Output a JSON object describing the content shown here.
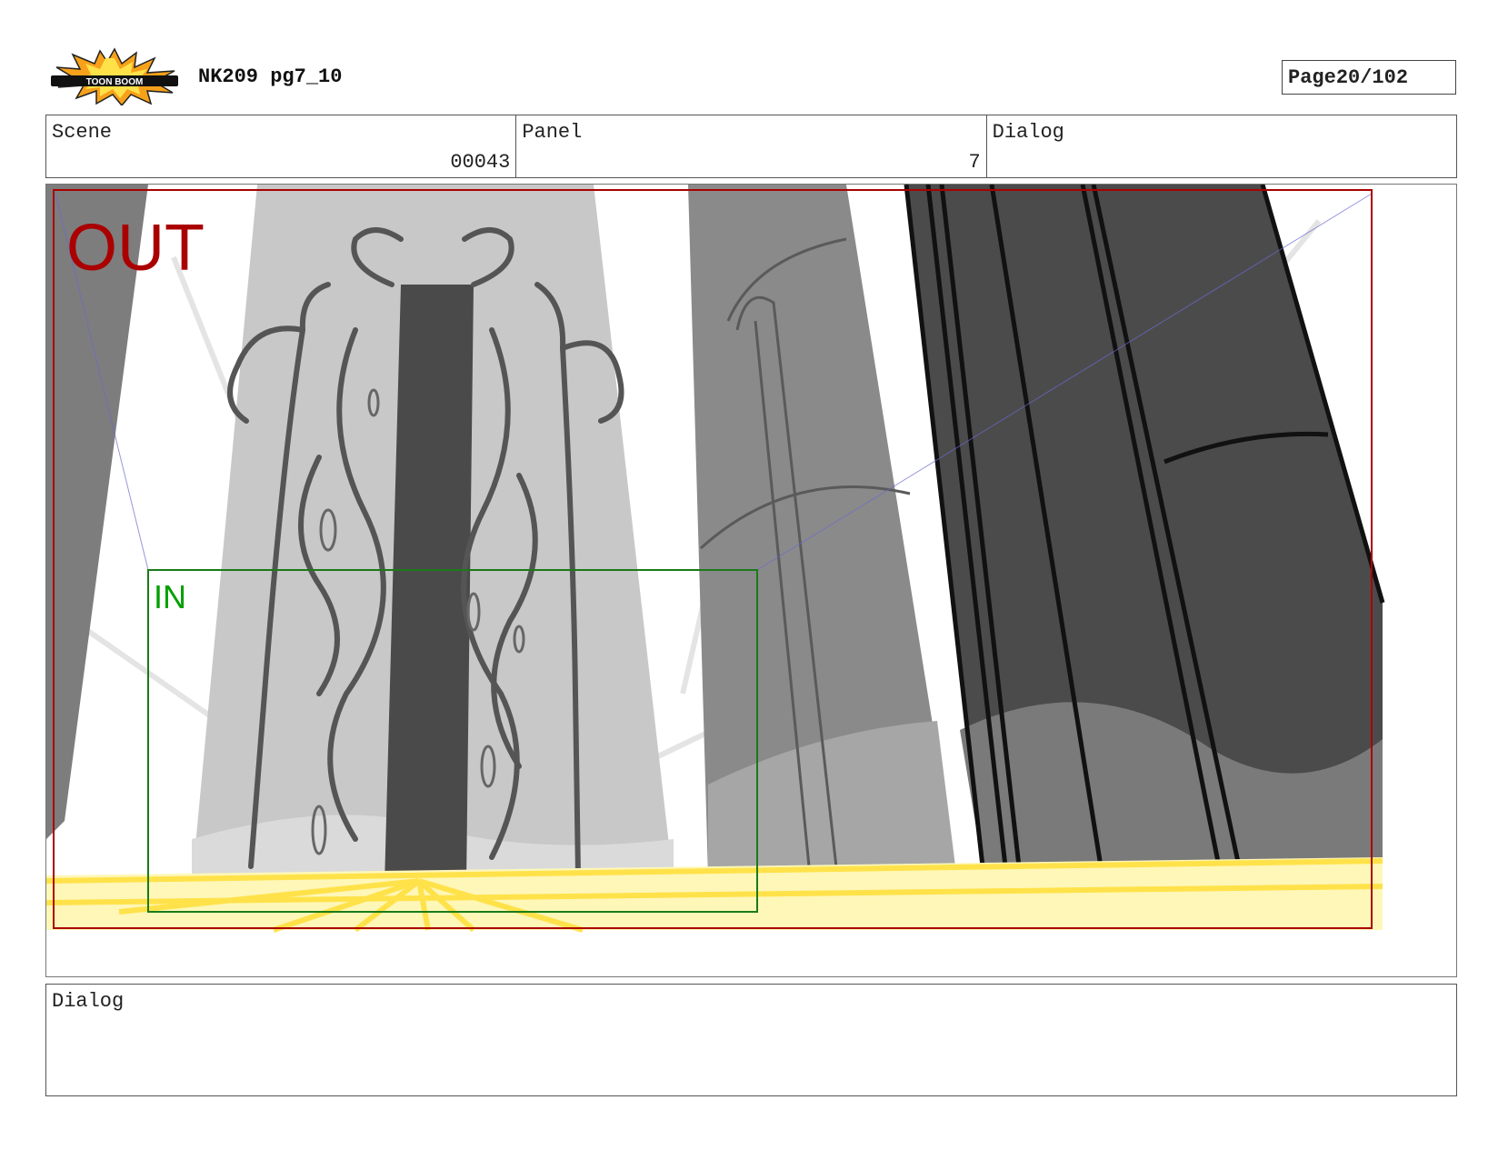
{
  "header": {
    "logo_text": "TOON BOOM",
    "title": "NK209 pg7_10",
    "page_label": "Page",
    "page_value": "20/102"
  },
  "info": {
    "scene_label": "Scene",
    "scene_value": "00043",
    "panel_label": "Panel",
    "panel_value": "7",
    "dialog_label": "Dialog",
    "dialog_value": ""
  },
  "frame": {
    "out_label": "OUT",
    "in_label": "IN",
    "out_color": "#aa0000",
    "in_color": "#00a000"
  },
  "footer": {
    "dialog_label": "Dialog",
    "dialog_text": ""
  },
  "icons": [
    "toon-boom-logo-icon"
  ]
}
